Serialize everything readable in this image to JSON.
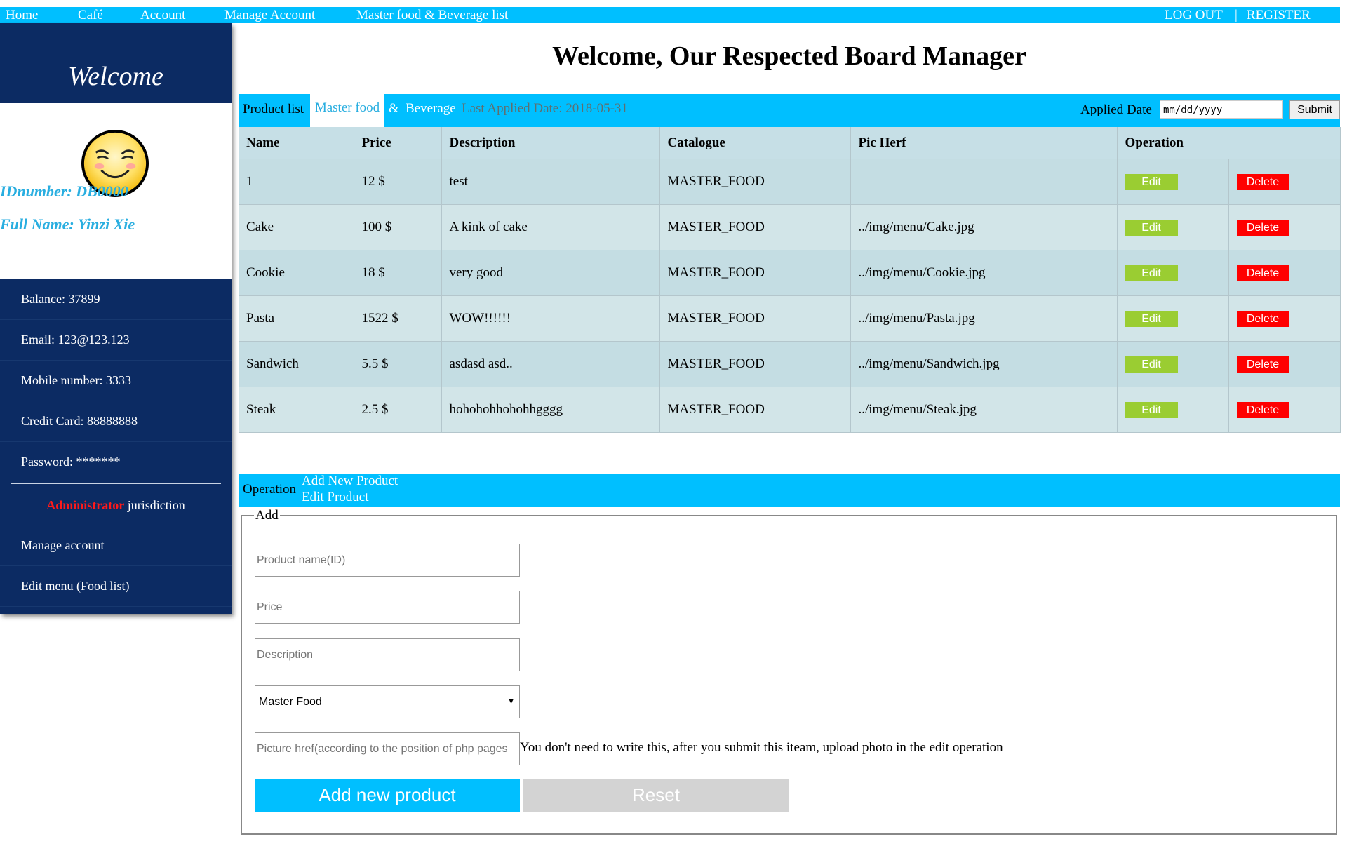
{
  "topnav": {
    "home": "Home",
    "cafe": "Café",
    "account": "Account",
    "manage_account": "Manage Account",
    "master_list": "Master food & Beverage list",
    "logout": "LOG OUT",
    "separator": "|",
    "register": "REGISTER"
  },
  "sidebar": {
    "welcome": "Welcome",
    "avatar_icon": "smiley-face",
    "id_number": "IDnumber: DB0000",
    "full_name": "Full Name: Yinzi Xie",
    "balance": "Balance: 37899",
    "email": "Email: 123@123.123",
    "mobile": "Mobile number: 3333",
    "credit_card": "Credit Card: 88888888",
    "password": "Password: *******",
    "admin_red": "Administrator",
    "admin_rest": " jurisdiction",
    "manage_account": "Manage account",
    "edit_menu": "Edit menu (Food list)"
  },
  "page_title": "Welcome, Our Respected Board Manager",
  "toolbar": {
    "product_list": "Product list",
    "master_food": "Master food",
    "ampersand": "&",
    "beverage": "Beverage",
    "last_applied": "Last Applied Date: 2018-05-31",
    "applied_date_label": "Applied Date",
    "date_placeholder": "mm/dd/yyyy",
    "submit": "Submit"
  },
  "table": {
    "headers": [
      "Name",
      "Price",
      "Description",
      "Catalogue",
      "Pic Herf",
      "Operation"
    ],
    "edit_label": "Edit",
    "delete_label": "Delete",
    "rows": [
      {
        "name": "1",
        "price": "12 $",
        "description": "test",
        "catalogue": "MASTER_FOOD",
        "pic": ""
      },
      {
        "name": "Cake",
        "price": "100 $",
        "description": "A kink of cake",
        "catalogue": "MASTER_FOOD",
        "pic": "../img/menu/Cake.jpg"
      },
      {
        "name": "Cookie",
        "price": "18 $",
        "description": "very good",
        "catalogue": "MASTER_FOOD",
        "pic": "../img/menu/Cookie.jpg"
      },
      {
        "name": "Pasta",
        "price": "1522 $",
        "description": "WOW!!!!!!",
        "catalogue": "MASTER_FOOD",
        "pic": "../img/menu/Pasta.jpg"
      },
      {
        "name": "Sandwich",
        "price": "5.5 $",
        "description": "asdasd asd..",
        "catalogue": "MASTER_FOOD",
        "pic": "../img/menu/Sandwich.jpg"
      },
      {
        "name": "Steak",
        "price": "2.5 $",
        "description": "hohohohhohohhgggg",
        "catalogue": "MASTER_FOOD",
        "pic": "../img/menu/Steak.jpg"
      }
    ]
  },
  "operation": {
    "label": "Operation",
    "add_new": "Add New Product",
    "edit": "Edit Product"
  },
  "add_form": {
    "legend": "Add",
    "name_placeholder": "Product name(ID)",
    "price_placeholder": "Price",
    "description_placeholder": "Description",
    "category_selected": "Master Food",
    "picture_placeholder": "Picture href(according to the position of php pages",
    "picture_hint": "You don't need to write this, after you submit this iteam, upload photo in the edit operation",
    "add_button": "Add new product",
    "reset_button": "Reset"
  },
  "colors": {
    "accent": "#00bfff",
    "sidebar": "#0c2b63",
    "edit": "#9acd32",
    "delete": "#ff0000"
  }
}
